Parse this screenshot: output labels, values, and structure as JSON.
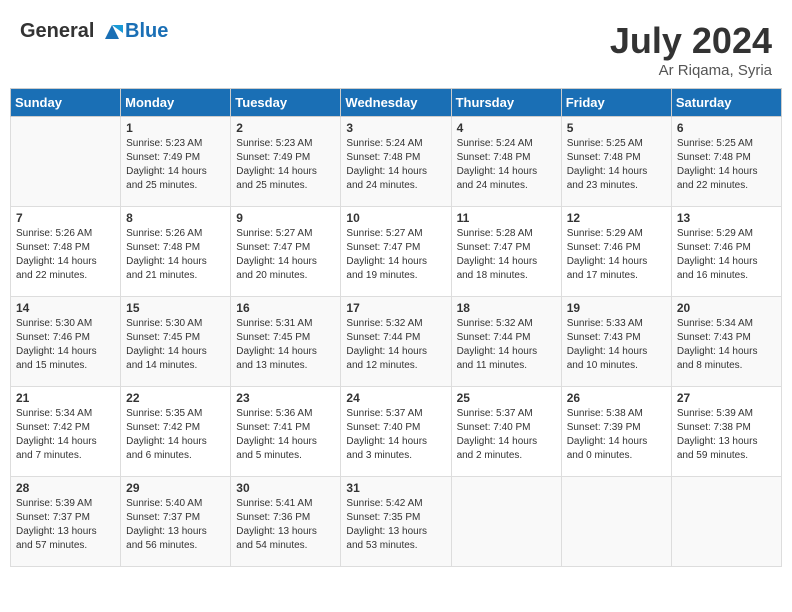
{
  "header": {
    "logo_line1": "General",
    "logo_line2": "Blue",
    "month_year": "July 2024",
    "location": "Ar Riqama, Syria"
  },
  "columns": [
    "Sunday",
    "Monday",
    "Tuesday",
    "Wednesday",
    "Thursday",
    "Friday",
    "Saturday"
  ],
  "weeks": [
    [
      {
        "day": "",
        "info": ""
      },
      {
        "day": "1",
        "info": "Sunrise: 5:23 AM\nSunset: 7:49 PM\nDaylight: 14 hours\nand 25 minutes."
      },
      {
        "day": "2",
        "info": "Sunrise: 5:23 AM\nSunset: 7:49 PM\nDaylight: 14 hours\nand 25 minutes."
      },
      {
        "day": "3",
        "info": "Sunrise: 5:24 AM\nSunset: 7:48 PM\nDaylight: 14 hours\nand 24 minutes."
      },
      {
        "day": "4",
        "info": "Sunrise: 5:24 AM\nSunset: 7:48 PM\nDaylight: 14 hours\nand 24 minutes."
      },
      {
        "day": "5",
        "info": "Sunrise: 5:25 AM\nSunset: 7:48 PM\nDaylight: 14 hours\nand 23 minutes."
      },
      {
        "day": "6",
        "info": "Sunrise: 5:25 AM\nSunset: 7:48 PM\nDaylight: 14 hours\nand 22 minutes."
      }
    ],
    [
      {
        "day": "7",
        "info": "Sunrise: 5:26 AM\nSunset: 7:48 PM\nDaylight: 14 hours\nand 22 minutes."
      },
      {
        "day": "8",
        "info": "Sunrise: 5:26 AM\nSunset: 7:48 PM\nDaylight: 14 hours\nand 21 minutes."
      },
      {
        "day": "9",
        "info": "Sunrise: 5:27 AM\nSunset: 7:47 PM\nDaylight: 14 hours\nand 20 minutes."
      },
      {
        "day": "10",
        "info": "Sunrise: 5:27 AM\nSunset: 7:47 PM\nDaylight: 14 hours\nand 19 minutes."
      },
      {
        "day": "11",
        "info": "Sunrise: 5:28 AM\nSunset: 7:47 PM\nDaylight: 14 hours\nand 18 minutes."
      },
      {
        "day": "12",
        "info": "Sunrise: 5:29 AM\nSunset: 7:46 PM\nDaylight: 14 hours\nand 17 minutes."
      },
      {
        "day": "13",
        "info": "Sunrise: 5:29 AM\nSunset: 7:46 PM\nDaylight: 14 hours\nand 16 minutes."
      }
    ],
    [
      {
        "day": "14",
        "info": "Sunrise: 5:30 AM\nSunset: 7:46 PM\nDaylight: 14 hours\nand 15 minutes."
      },
      {
        "day": "15",
        "info": "Sunrise: 5:30 AM\nSunset: 7:45 PM\nDaylight: 14 hours\nand 14 minutes."
      },
      {
        "day": "16",
        "info": "Sunrise: 5:31 AM\nSunset: 7:45 PM\nDaylight: 14 hours\nand 13 minutes."
      },
      {
        "day": "17",
        "info": "Sunrise: 5:32 AM\nSunset: 7:44 PM\nDaylight: 14 hours\nand 12 minutes."
      },
      {
        "day": "18",
        "info": "Sunrise: 5:32 AM\nSunset: 7:44 PM\nDaylight: 14 hours\nand 11 minutes."
      },
      {
        "day": "19",
        "info": "Sunrise: 5:33 AM\nSunset: 7:43 PM\nDaylight: 14 hours\nand 10 minutes."
      },
      {
        "day": "20",
        "info": "Sunrise: 5:34 AM\nSunset: 7:43 PM\nDaylight: 14 hours\nand 8 minutes."
      }
    ],
    [
      {
        "day": "21",
        "info": "Sunrise: 5:34 AM\nSunset: 7:42 PM\nDaylight: 14 hours\nand 7 minutes."
      },
      {
        "day": "22",
        "info": "Sunrise: 5:35 AM\nSunset: 7:42 PM\nDaylight: 14 hours\nand 6 minutes."
      },
      {
        "day": "23",
        "info": "Sunrise: 5:36 AM\nSunset: 7:41 PM\nDaylight: 14 hours\nand 5 minutes."
      },
      {
        "day": "24",
        "info": "Sunrise: 5:37 AM\nSunset: 7:40 PM\nDaylight: 14 hours\nand 3 minutes."
      },
      {
        "day": "25",
        "info": "Sunrise: 5:37 AM\nSunset: 7:40 PM\nDaylight: 14 hours\nand 2 minutes."
      },
      {
        "day": "26",
        "info": "Sunrise: 5:38 AM\nSunset: 7:39 PM\nDaylight: 14 hours\nand 0 minutes."
      },
      {
        "day": "27",
        "info": "Sunrise: 5:39 AM\nSunset: 7:38 PM\nDaylight: 13 hours\nand 59 minutes."
      }
    ],
    [
      {
        "day": "28",
        "info": "Sunrise: 5:39 AM\nSunset: 7:37 PM\nDaylight: 13 hours\nand 57 minutes."
      },
      {
        "day": "29",
        "info": "Sunrise: 5:40 AM\nSunset: 7:37 PM\nDaylight: 13 hours\nand 56 minutes."
      },
      {
        "day": "30",
        "info": "Sunrise: 5:41 AM\nSunset: 7:36 PM\nDaylight: 13 hours\nand 54 minutes."
      },
      {
        "day": "31",
        "info": "Sunrise: 5:42 AM\nSunset: 7:35 PM\nDaylight: 13 hours\nand 53 minutes."
      },
      {
        "day": "",
        "info": ""
      },
      {
        "day": "",
        "info": ""
      },
      {
        "day": "",
        "info": ""
      }
    ]
  ]
}
